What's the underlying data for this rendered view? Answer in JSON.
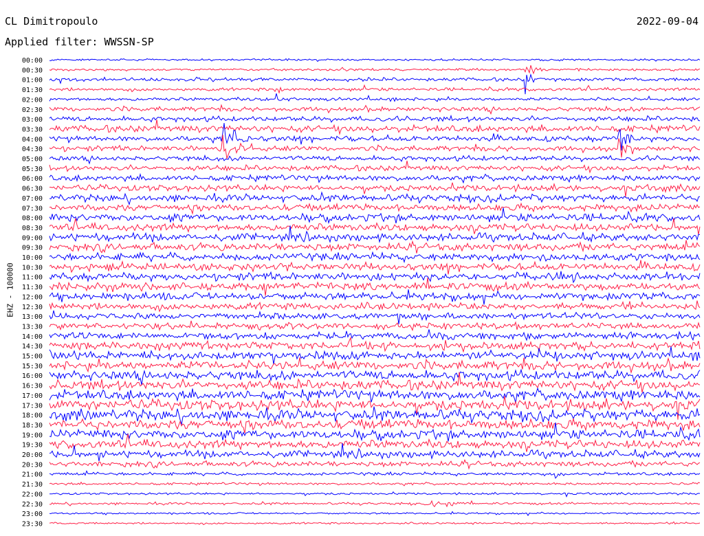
{
  "header": {
    "station": "CL Dimitropoulo",
    "filter": "Applied filter: WWSSN-SP",
    "date": "2022-09-04",
    "channel_label": "EHZ - 100000"
  },
  "chart_data": {
    "type": "line",
    "title": "CL Dimitropoulo",
    "subtitle": "Applied filter: WWSSN-SP",
    "date": "2022-09-04",
    "ylabel": "EHZ - 100000",
    "xlabel": "",
    "row_labels": [
      "00:00",
      "00:30",
      "01:00",
      "01:30",
      "02:00",
      "02:30",
      "03:00",
      "03:30",
      "04:00",
      "04:30",
      "05:00",
      "05:30",
      "06:00",
      "06:30",
      "07:00",
      "07:30",
      "08:00",
      "08:30",
      "09:00",
      "09:30",
      "10:00",
      "10:30",
      "11:00",
      "11:30",
      "12:00",
      "12:30",
      "13:00",
      "13:30",
      "14:00",
      "14:30",
      "15:00",
      "15:30",
      "16:00",
      "16:30",
      "17:00",
      "17:30",
      "18:00",
      "18:30",
      "19:00",
      "19:30",
      "20:00",
      "20:30",
      "21:00",
      "21:30",
      "22:00",
      "22:30",
      "23:00",
      "23:30"
    ],
    "row_colors": [
      "#0000ff",
      "#ff1e46"
    ],
    "noise_level": [
      0.9,
      1.1,
      1.6,
      1.5,
      1.6,
      2.2,
      2.4,
      3.2,
      2.6,
      2.5,
      2.4,
      2.6,
      2.8,
      3.0,
      3.2,
      3.3,
      3.6,
      3.5,
      3.6,
      3.6,
      3.6,
      3.4,
      3.6,
      3.8,
      3.6,
      3.3,
      3.0,
      3.0,
      3.4,
      3.8,
      4.1,
      4.3,
      4.5,
      4.6,
      4.8,
      5.0,
      4.9,
      4.8,
      4.4,
      4.0,
      3.4,
      2.6,
      1.5,
      1.2,
      1.0,
      1.1,
      0.9,
      0.9
    ],
    "events": [
      {
        "start": "00:30",
        "end": "01:30",
        "x_start": 0.73,
        "x_end": 0.755,
        "amplitude": 20
      },
      {
        "start": "01:30",
        "end": "02:30",
        "x_start": 0.345,
        "x_end": 0.36,
        "amplitude": 16
      },
      {
        "start": "04:00",
        "end": "05:00",
        "x_start": 0.265,
        "x_end": 0.315,
        "amplitude": 22
      },
      {
        "start": "04:00",
        "end": "05:00",
        "x_start": 0.875,
        "x_end": 0.905,
        "amplitude": 20
      },
      {
        "start": "21:00",
        "end": "21:30",
        "x_start": 0.775,
        "x_end": 0.79,
        "amplitude": 16
      },
      {
        "start": "22:30",
        "end": "23:00",
        "x_start": 0.61,
        "x_end": 0.64,
        "amplitude": 14
      },
      {
        "start": "22:30",
        "end": "23:00",
        "x_start": 0.58,
        "x_end": 0.6,
        "amplitude": 12
      }
    ],
    "x_range": [
      0,
      1
    ],
    "grid": false,
    "legend": "none"
  },
  "colors": {
    "odd_trace": "#0000ff",
    "even_trace": "#ff1e46",
    "background": "#ffffff",
    "text": "#000000"
  }
}
